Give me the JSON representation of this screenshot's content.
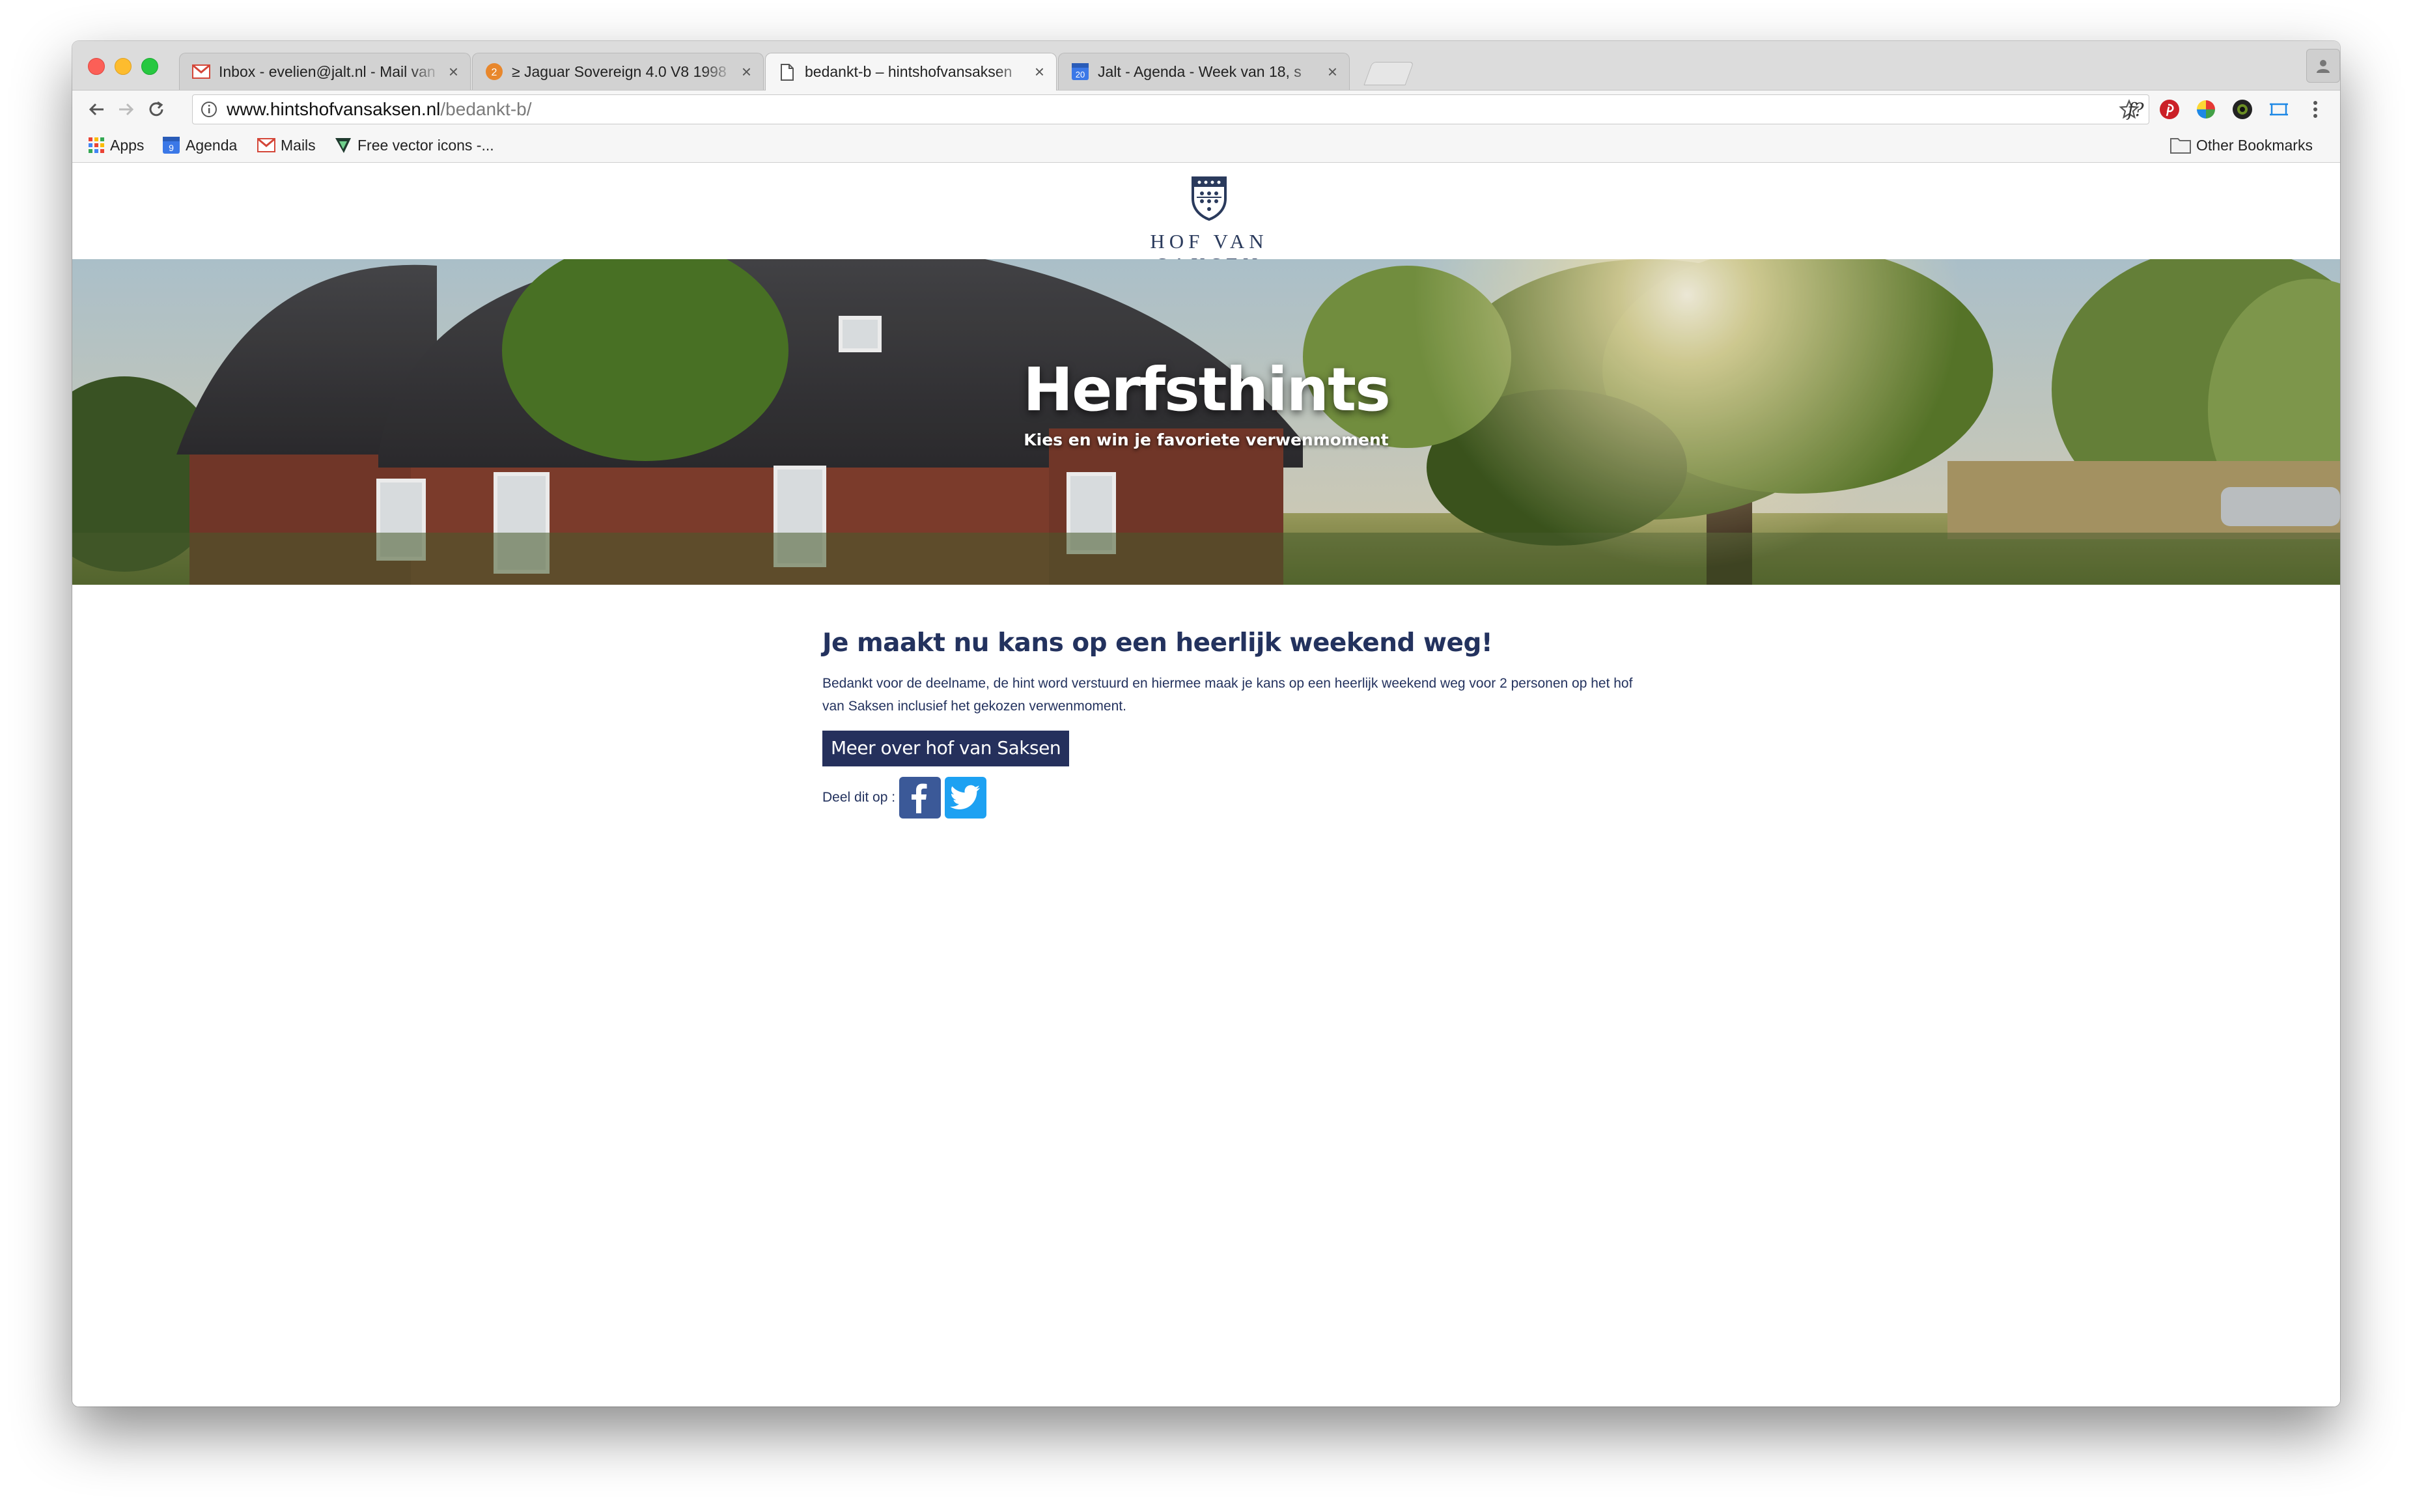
{
  "tabs": [
    {
      "title": "Inbox - evelien@jalt.nl - Mail van",
      "icon": "gmail-icon",
      "active": false
    },
    {
      "title": "≥ Jaguar Sovereign 4.0 V8 1998",
      "icon": "tab-badge-icon",
      "badge": "2",
      "active": false
    },
    {
      "title": "bedankt-b – hintshofvansaksen",
      "icon": "page-icon",
      "active": true
    },
    {
      "title": "Jalt - Agenda - Week van 18, s",
      "icon": "calendar-icon",
      "badge": "20",
      "active": false
    }
  ],
  "address_bar": {
    "host": "www.hintshofvansaksen.nl",
    "path": "/bedankt-b/"
  },
  "bookmarks": [
    {
      "label": "Apps",
      "icon": "apps-grid-icon"
    },
    {
      "label": "Agenda",
      "icon": "calendar-icon",
      "badge": "9"
    },
    {
      "label": "Mails",
      "icon": "gmail-icon"
    },
    {
      "label": "Free vector icons -...",
      "icon": "freepik-icon"
    }
  ],
  "other_bookmarks": "Other Bookmarks",
  "extensions_glyph": "f?",
  "logo": {
    "text": "HOF VAN SAKSEN"
  },
  "hero": {
    "title": "Herfsthints",
    "subtitle": "Kies en win je favoriete verwenmoment"
  },
  "content": {
    "headline": "Je maakt nu kans op een heerlijk weekend weg!",
    "body": "Bedankt voor de deelname, de hint word verstuurd en hiermee maak je kans op een heerlijk weekend weg voor 2 personen op het hof van Saksen inclusief het gekozen verwenmoment.",
    "cta": "Meer over hof van Saksen",
    "share_label": "Deel dit op :"
  },
  "colors": {
    "brand_navy": "#25305c",
    "facebook": "#3b5998",
    "twitter": "#1da1f2"
  }
}
